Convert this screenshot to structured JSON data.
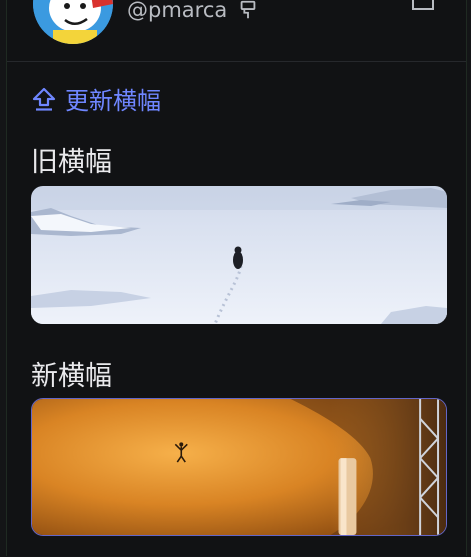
{
  "profile": {
    "handle": "@pmarca"
  },
  "actions": {
    "update_banner_label": "更新横幅"
  },
  "sections": {
    "old_banner_title": "旧横幅",
    "new_banner_title": "新横幅"
  },
  "icons": {
    "handle_badge": "brush-icon",
    "open_external": "external-link-icon",
    "update": "upload-arrow-icon"
  },
  "colors": {
    "accent": "#6f86ff",
    "background": "#111214"
  }
}
